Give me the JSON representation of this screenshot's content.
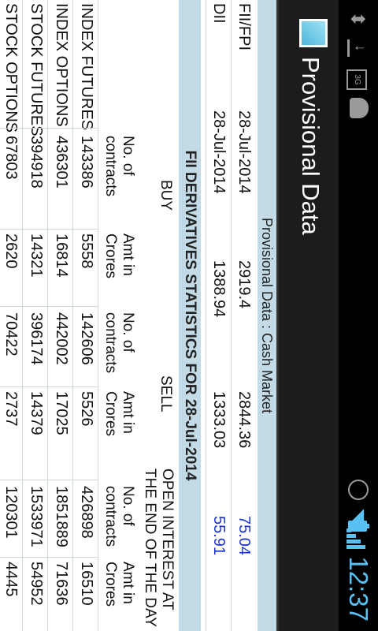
{
  "status_bar": {
    "time": "12:37",
    "network_type": "3G",
    "icons": [
      "usb-icon",
      "download-icon",
      "3g-icon",
      "android-debug-icon",
      "alarm-icon",
      "wifi-icon",
      "signal-icon",
      "battery-icon"
    ],
    "accent_color": "#58c0f2"
  },
  "action_bar": {
    "title": "Provisional Data",
    "icon": "app-icon"
  },
  "cash_market": {
    "header": "Provisional Data : Cash Market",
    "rows": [
      {
        "label": "FII/FPI",
        "date": "28-Jul-2014",
        "buy": "2919.4",
        "sell": "2844.36",
        "net": "75.04"
      },
      {
        "label": "DII",
        "date": "28-Jul-2014",
        "buy": "1388.94",
        "sell": "1333.03",
        "net": "55.91"
      }
    ],
    "net_color": "#1a33d6"
  },
  "derivatives": {
    "title": "FII DERIVATIVES STATISTICS FOR 28-Jul-2014",
    "groups": {
      "buy": "BUY",
      "sell": "SELL",
      "oi_line1": "OPEN INTEREST AT",
      "oi_line2": "THE END OF THE DAY"
    },
    "col_headers": {
      "contracts_line1": "No. of",
      "contracts_line2": "contracts",
      "amount_line1": "Amt in",
      "amount_line2": "Crores"
    },
    "rows": [
      {
        "label": "INDEX FUTURES",
        "buy_contracts": "143386",
        "buy_amount": "5558",
        "sell_contracts": "142606",
        "sell_amount": "5526",
        "oi_contracts": "426898",
        "oi_amount": "16510"
      },
      {
        "label": "INDEX OPTIONS",
        "buy_contracts": "436301",
        "buy_amount": "16814",
        "sell_contracts": "442002",
        "sell_amount": "17025",
        "oi_contracts": "1851889",
        "oi_amount": "71636"
      },
      {
        "label": "STOCK FUTURES",
        "buy_contracts": "394918",
        "buy_amount": "14321",
        "sell_contracts": "396174",
        "sell_amount": "14379",
        "oi_contracts": "1533971",
        "oi_amount": "54952"
      },
      {
        "label": "STOCK OPTIONS",
        "buy_contracts": "67803",
        "buy_amount": "2620",
        "sell_contracts": "70422",
        "sell_amount": "2737",
        "oi_contracts": "120301",
        "oi_amount": "4445"
      }
    ]
  }
}
